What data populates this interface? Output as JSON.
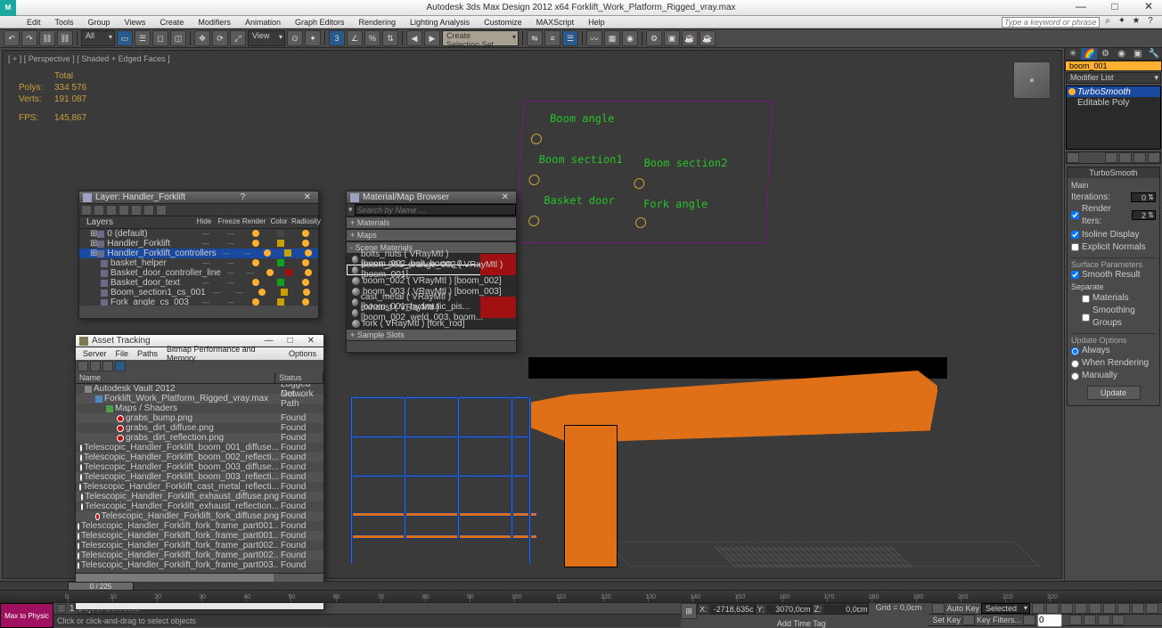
{
  "title": "Autodesk 3ds Max Design 2012 x64     Forklift_Work_Platform_Rigged_vray.max",
  "menus": [
    "Edit",
    "Tools",
    "Group",
    "Views",
    "Create",
    "Modifiers",
    "Animation",
    "Graph Editors",
    "Rendering",
    "Lighting Analysis",
    "Customize",
    "MAXScript",
    "Help"
  ],
  "search_placeholder": "Type a keyword or phrase",
  "toolbar": {
    "selfilter": "All",
    "viewmode": "View",
    "selset": "Create Selection Set"
  },
  "viewport": {
    "label": "[ + ] [ Perspective ] [ Shaded + Edged Faces ]",
    "stats": {
      "total": "Total",
      "polys_k": "Polys:",
      "polys_v": "334 576",
      "verts_k": "Verts:",
      "verts_v": "191 087",
      "fps_k": "FPS:",
      "fps_v": "145,867"
    },
    "controls": {
      "boom_angle": "Boom angle",
      "boom_sec1": "Boom section1",
      "boom_sec2": "Boom section2",
      "basket_door": "Basket door",
      "fork_angle": "Fork angle"
    }
  },
  "layer_panel": {
    "title": "Layer: Handler_Forklift",
    "headers": [
      "Layers",
      "Hide",
      "Freeze",
      "Render",
      "Color",
      "Radiosity"
    ],
    "rows": [
      {
        "indent": 0,
        "icon": "layer",
        "name": "0 (default)",
        "color": "#444"
      },
      {
        "indent": 0,
        "icon": "layer",
        "name": "Handler_Forklift",
        "color": "#c8a000"
      },
      {
        "indent": 0,
        "icon": "layer",
        "name": "Handler_Forklift_controllers",
        "sel": true,
        "color": "#c8a000"
      },
      {
        "indent": 1,
        "icon": "obj",
        "name": "basket_helper",
        "color": "#10a020"
      },
      {
        "indent": 1,
        "icon": "obj",
        "name": "Basket_door_controller_line",
        "color": "#a01010"
      },
      {
        "indent": 1,
        "icon": "obj",
        "name": "Basket_door_text",
        "color": "#10a020"
      },
      {
        "indent": 1,
        "icon": "obj",
        "name": "Boom_section1_cs_001",
        "color": "#c8a000"
      },
      {
        "indent": 1,
        "icon": "obj",
        "name": "Fork_angle_cs_003",
        "color": "#c8a000"
      }
    ]
  },
  "material_panel": {
    "title": "Material/Map Browser",
    "search_label": "▾",
    "search_placeholder": "Search by Name ...",
    "groups": {
      "materials": "+ Materials",
      "maps": "+ Maps",
      "scene": "- Scene Materials",
      "sample": "+ Sample Slots"
    },
    "rows": [
      {
        "name": "bolts_nuts ( VRayMtl ) [boom_002_bolt, boom_0...",
        "hot": true
      },
      {
        "name": "boom_001_orange_002 ( VRayMtl ) [boom_001]",
        "sel": true,
        "hot": true
      },
      {
        "name": "boom_002 ( VRayMtl ) [boom_002]"
      },
      {
        "name": "boom_003 ( VRayMtl ) [boom_003]"
      },
      {
        "name": "cast_metal ( VRayMtl ) [boom_001_hydraulic_pis...",
        "hot": true
      },
      {
        "name": "exhaust ( VRayMtl ) [boom_002_weld_003, boom...",
        "hot": true
      },
      {
        "name": "fork ( VRayMtl ) [fork_rod]"
      }
    ]
  },
  "asset_panel": {
    "title": "Asset Tracking",
    "menus": [
      "Server",
      "File",
      "Paths",
      "Bitmap Performance and Memory",
      "Options"
    ],
    "headers": {
      "name": "Name",
      "status": "Status"
    },
    "rows": [
      {
        "indent": 0,
        "type": "root",
        "name": "Autodesk Vault 2012",
        "status": "Logged Out ..."
      },
      {
        "indent": 1,
        "type": "scene",
        "name": "Forklift_Work_Platform_Rigged_vray.max",
        "status": "Network Path"
      },
      {
        "indent": 2,
        "type": "group",
        "name": "Maps / Shaders",
        "status": ""
      },
      {
        "indent": 3,
        "type": "map",
        "name": "grabs_bump.png",
        "status": "Found"
      },
      {
        "indent": 3,
        "type": "map",
        "name": "grabs_dirt_diffuse.png",
        "status": "Found"
      },
      {
        "indent": 3,
        "type": "map",
        "name": "grabs_dirt_reflection.png",
        "status": "Found"
      },
      {
        "indent": 3,
        "type": "map",
        "name": "Telescopic_Handler_Forklift_boom_001_diffuse...",
        "status": "Found"
      },
      {
        "indent": 3,
        "type": "map",
        "name": "Telescopic_Handler_Forklift_boom_002_reflecti...",
        "status": "Found"
      },
      {
        "indent": 3,
        "type": "map",
        "name": "Telescopic_Handler_Forklift_boom_003_diffuse...",
        "status": "Found"
      },
      {
        "indent": 3,
        "type": "map",
        "name": "Telescopic_Handler_Forklift_boom_003_reflecti...",
        "status": "Found"
      },
      {
        "indent": 3,
        "type": "map",
        "name": "Telescopic_Handler_Forklift_cast_metal_reflecti...",
        "status": "Found"
      },
      {
        "indent": 3,
        "type": "map",
        "name": "Telescopic_Handler_Forklift_exhaust_diffuse.png",
        "status": "Found"
      },
      {
        "indent": 3,
        "type": "map",
        "name": "Telescopic_Handler_Forklift_exhaust_reflection...",
        "status": "Found"
      },
      {
        "indent": 3,
        "type": "map",
        "name": "Telescopic_Handler_Forklift_fork_diffuse.png",
        "status": "Found"
      },
      {
        "indent": 3,
        "type": "map",
        "name": "Telescopic_Handler_Forklift_fork_frame_part001...",
        "status": "Found"
      },
      {
        "indent": 3,
        "type": "map",
        "name": "Telescopic_Handler_Forklift_fork_frame_part001...",
        "status": "Found"
      },
      {
        "indent": 3,
        "type": "map",
        "name": "Telescopic_Handler_Forklift_fork_frame_part002...",
        "status": "Found"
      },
      {
        "indent": 3,
        "type": "map",
        "name": "Telescopic_Handler_Forklift_fork_frame_part002...",
        "status": "Found"
      },
      {
        "indent": 3,
        "type": "map",
        "name": "Telescopic_Handler_Forklift_fork_frame_part003...",
        "status": "Found"
      }
    ]
  },
  "cmdpanel": {
    "objname": "boom_001",
    "modlist_label": "Modifier List",
    "mods": [
      {
        "name": "TurboSmooth",
        "sel": true
      },
      {
        "name": "Editable Poly"
      }
    ],
    "rollout_title": "TurboSmooth",
    "main_label": "Main",
    "iterations_label": "Iterations:",
    "iterations_val": "0",
    "render_iters_label": "Render Iters:",
    "render_iters_val": "2",
    "isoline": "Isoline Display",
    "explicit": "Explicit Normals",
    "surface_label": "Surface Parameters",
    "smooth_result": "Smooth Result",
    "separate_label": "Separate",
    "sep_materials": "Materials",
    "sep_smoothing": "Smoothing Groups",
    "update_label": "Update Options",
    "upd_always": "Always",
    "upd_render": "When Rendering",
    "upd_manual": "Manually",
    "update_btn": "Update"
  },
  "timeslider": {
    "label": "0 / 225"
  },
  "timeline_ticks": [
    "0",
    "10",
    "20",
    "30",
    "40",
    "50",
    "60",
    "70",
    "80",
    "90",
    "100",
    "110",
    "120",
    "130",
    "140",
    "150",
    "160",
    "170",
    "180",
    "190",
    "200",
    "210",
    "220"
  ],
  "status": {
    "leftlabel": "Max to Physic",
    "selinfo": "1 Object Selected",
    "hint": "Click or click-and-drag to select objects",
    "x": "-2718,635c",
    "y": "3070,0cm",
    "z": "0,0cm",
    "grid": "Grid = 0,0cm",
    "addtag": "Add Time Tag",
    "autokey": "Auto Key",
    "setkey": "Set Key",
    "seldrop": "Selected",
    "keyfilters": "Key Filters..."
  }
}
